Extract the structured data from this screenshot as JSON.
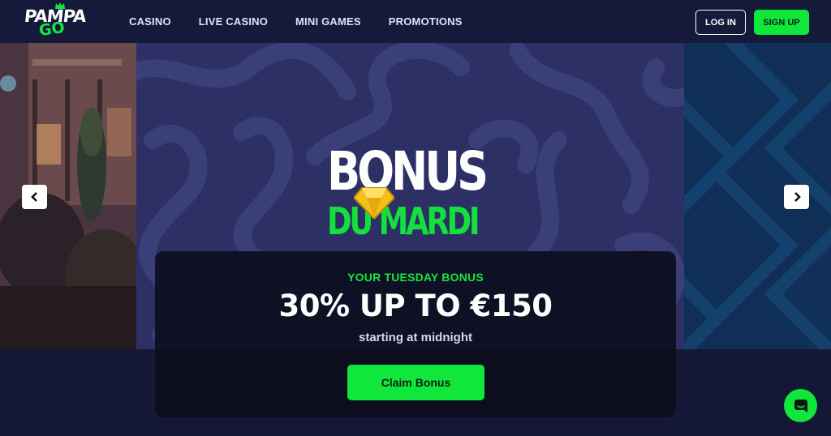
{
  "brand": {
    "logo_top": "PAMPA",
    "logo_bottom": "GO",
    "accent": "#0fe83a"
  },
  "nav": {
    "items": [
      {
        "label": "CASINO"
      },
      {
        "label": "LIVE CASINO"
      },
      {
        "label": "MINI GAMES"
      },
      {
        "label": "PROMOTIONS"
      }
    ]
  },
  "auth": {
    "login_label": "LOG IN",
    "signup_label": "SIGN UP"
  },
  "carousel": {
    "prev_icon": "chevron-left-icon",
    "next_icon": "chevron-right-icon",
    "slide_title_line1": "BONUS",
    "slide_title_line2": "DU MARDI",
    "badge_icon": "diamond-icon"
  },
  "promo": {
    "eyebrow": "YOUR TUESDAY BONUS",
    "headline": "30% UP TO €150",
    "note": "starting at midnight",
    "cta_label": "Claim Bonus"
  },
  "support": {
    "chat_icon": "chat-bubble-icon"
  }
}
